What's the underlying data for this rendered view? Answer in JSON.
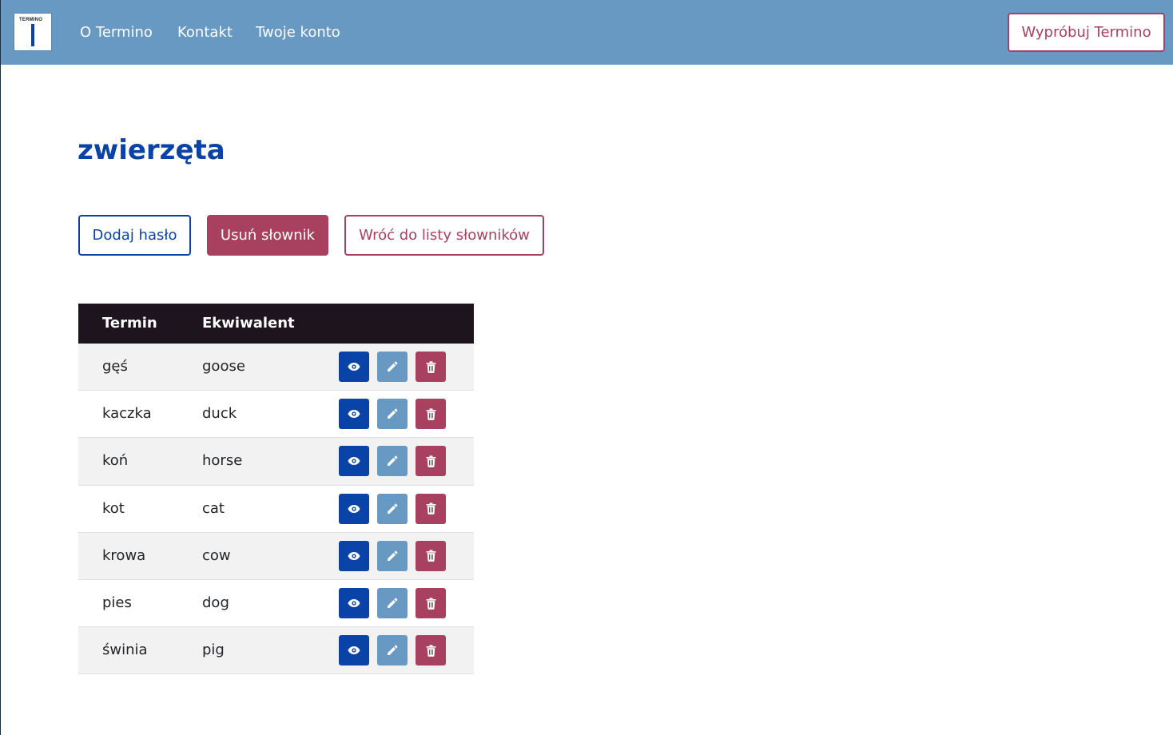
{
  "navbar": {
    "logo_text": "TERMINO",
    "links": [
      "O Termino",
      "Kontakt",
      "Twoje konto"
    ],
    "cta_label": "Wypróbuj Termino"
  },
  "page": {
    "title": "zwierzęta",
    "actions": {
      "add_label": "Dodaj hasło",
      "delete_label": "Usuń słownik",
      "back_label": "Wróć do listy słowników"
    }
  },
  "table": {
    "headers": [
      "Termin",
      "Ekwiwalent"
    ],
    "rows": [
      {
        "term": "gęś",
        "equivalent": "goose"
      },
      {
        "term": "kaczka",
        "equivalent": "duck"
      },
      {
        "term": "koń",
        "equivalent": "horse"
      },
      {
        "term": "kot",
        "equivalent": "cat"
      },
      {
        "term": "krowa",
        "equivalent": "cow"
      },
      {
        "term": "pies",
        "equivalent": "dog"
      },
      {
        "term": "świnia",
        "equivalent": "pig"
      }
    ],
    "row_action_icons": [
      "eye-icon",
      "pencil-icon",
      "trash-icon"
    ]
  },
  "colors": {
    "navbar_bg": "#6899c3",
    "primary": "#0a43a8",
    "danger": "#a8405f",
    "table_header_bg": "#1e141e"
  }
}
